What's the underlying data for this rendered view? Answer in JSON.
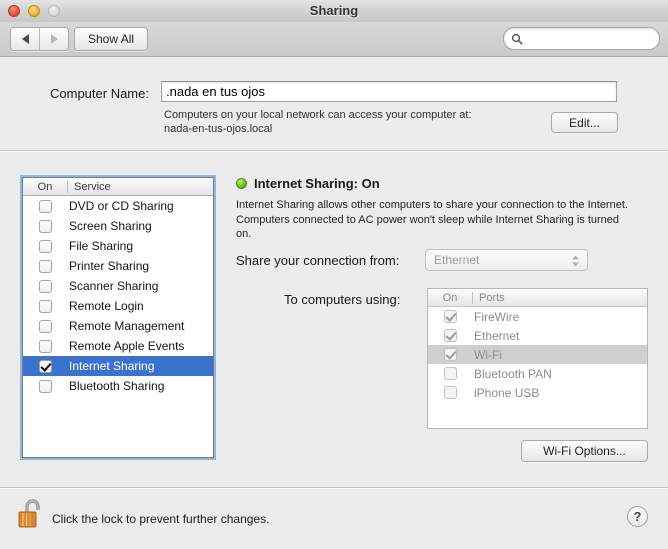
{
  "window": {
    "title": "Sharing",
    "traffic_lights": [
      "close-button",
      "minimize-button",
      "zoom-button"
    ]
  },
  "toolbar": {
    "back_label": "back-arrow",
    "forward_label": "forward-arrow",
    "show_all_label": "Show All",
    "search_placeholder": "",
    "search_value": ""
  },
  "computer_name": {
    "label": "Computer Name:",
    "value": ".nada en tus ojos",
    "note_line1": "Computers on your local network can access your computer at:",
    "note_line2": "nada-en-tus-ojos.local",
    "edit_label": "Edit..."
  },
  "services": {
    "header_on": "On",
    "header_name": "Service",
    "items": [
      {
        "label": "DVD or CD Sharing",
        "checked": false,
        "selected": false
      },
      {
        "label": "Screen Sharing",
        "checked": false,
        "selected": false
      },
      {
        "label": "File Sharing",
        "checked": false,
        "selected": false
      },
      {
        "label": "Printer Sharing",
        "checked": false,
        "selected": false
      },
      {
        "label": "Scanner Sharing",
        "checked": false,
        "selected": false
      },
      {
        "label": "Remote Login",
        "checked": false,
        "selected": false
      },
      {
        "label": "Remote Management",
        "checked": false,
        "selected": false
      },
      {
        "label": "Remote Apple Events",
        "checked": false,
        "selected": false
      },
      {
        "label": "Internet Sharing",
        "checked": true,
        "selected": true
      },
      {
        "label": "Bluetooth Sharing",
        "checked": false,
        "selected": false
      }
    ]
  },
  "detail": {
    "status_title": "Internet Sharing: On",
    "status_color": "#79cc2d",
    "description": "Internet Sharing allows other computers to share your connection to the Internet. Computers connected to AC power won't sleep while Internet Sharing is turned on.",
    "share_from_label": "Share your connection from:",
    "share_from_value": "Ethernet",
    "to_computers_label": "To computers using:",
    "ports_header_on": "On",
    "ports_header_name": "Ports",
    "ports": [
      {
        "label": "FireWire",
        "checked": true,
        "highlight": false
      },
      {
        "label": "Ethernet",
        "checked": true,
        "highlight": false
      },
      {
        "label": "Wi-Fi",
        "checked": true,
        "highlight": true
      },
      {
        "label": "Bluetooth PAN",
        "checked": false,
        "highlight": false
      },
      {
        "label": "iPhone USB",
        "checked": false,
        "highlight": false
      }
    ],
    "wifi_options_label": "Wi-Fi Options..."
  },
  "footer": {
    "lock_text": "Click the lock to prevent further changes.",
    "lock_state": "unlocked",
    "help_label": "?"
  }
}
